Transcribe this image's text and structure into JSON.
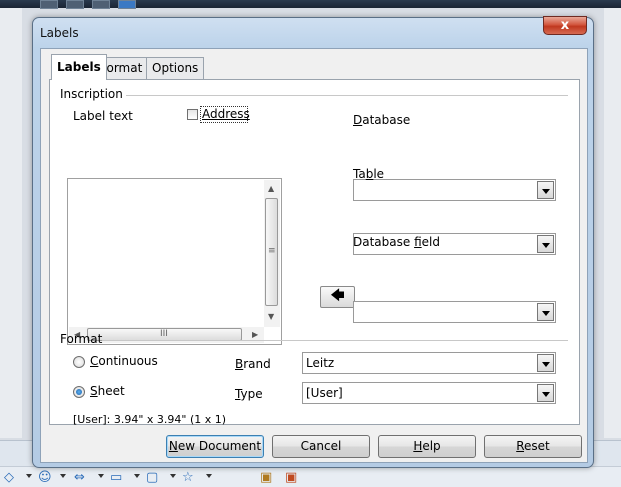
{
  "dialog": {
    "title": "Labels",
    "close_symbol": "x"
  },
  "tabs": [
    {
      "label": "Labels",
      "active": true
    },
    {
      "label": "Format",
      "active": false
    },
    {
      "label": "Options",
      "active": false
    }
  ],
  "inscription": {
    "group_label": "Inscription",
    "label_text_label": "Label text",
    "address_checkbox": {
      "label": "Address",
      "checked": false
    },
    "label_text_value": "",
    "database": {
      "label_pre": "",
      "label_u": "D",
      "label_post": "atabase",
      "value": ""
    },
    "table": {
      "label_pre": "Ta",
      "label_u": "b",
      "label_post": "le",
      "value": ""
    },
    "database_field": {
      "label_pre": "Database ",
      "label_u": "f",
      "label_post": "ield",
      "value": ""
    },
    "insert_button_icon": "left-arrow-icon"
  },
  "format": {
    "group_label": "Format",
    "continuous": {
      "label_u": "C",
      "label_post": "ontinuous",
      "selected": false
    },
    "sheet": {
      "label_u": "S",
      "label_post": "heet",
      "selected": true
    },
    "brand": {
      "label_u": "B",
      "label_post": "rand",
      "value": "Leitz"
    },
    "type": {
      "label_u": "T",
      "label_post": "ype",
      "value": "[User]"
    },
    "summary": "[User]: 3.94\" x 3.94\" (1 x 1)"
  },
  "buttons": {
    "new_document": {
      "label_u": "N",
      "label_post": "ew Document"
    },
    "cancel": "Cancel",
    "help": {
      "label_u": "H",
      "label_post": "elp"
    },
    "reset": {
      "label_u": "R",
      "label_post": "eset"
    }
  },
  "scrollbar_glyphs": {
    "up": "▲",
    "down": "▼",
    "left": "◀",
    "right": "▶",
    "grip_v": "≡",
    "grip_h": "III"
  },
  "colors": {
    "title_bar": "#bcd3ea",
    "close_button": "#c0381f",
    "radio_selected": "#1b5fa8"
  }
}
